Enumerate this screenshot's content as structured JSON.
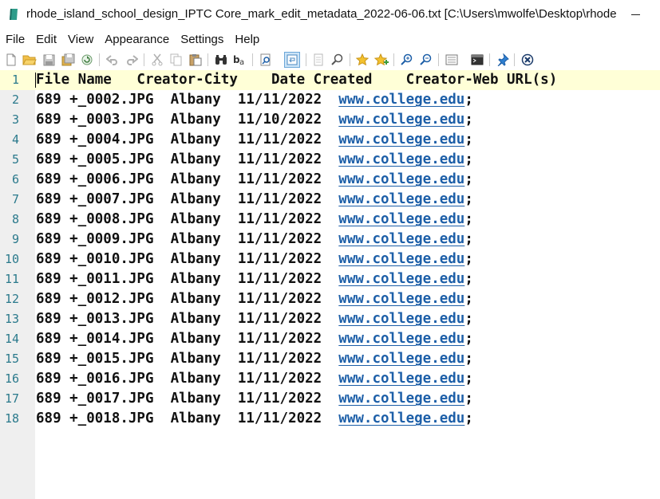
{
  "window": {
    "title": "rhode_island_school_design_IPTC Core_mark_edit_metadata_2022-06-06.txt [C:\\Users\\mwolfe\\Desktop\\rhode...",
    "minimize_label": "Minimize"
  },
  "menu": [
    "File",
    "Edit",
    "View",
    "Appearance",
    "Settings",
    "Help"
  ],
  "toolbar": {
    "icons": [
      "new-file-icon",
      "open-folder-icon",
      "save-icon",
      "save-all-icon",
      "reload-icon",
      "undo-icon",
      "redo-icon",
      "cut-icon",
      "copy-icon",
      "paste-icon",
      "find-icon",
      "replace-icon",
      "find-in-files-icon",
      "word-wrap-icon",
      "select-all-icon",
      "go-to-icon",
      "bookmark-icon",
      "bookmark-all-icon",
      "zoom-in-icon",
      "zoom-out-icon",
      "view-panel-icon",
      "terminal-icon",
      "pin-icon",
      "close-icon"
    ]
  },
  "editor": {
    "current_line": 1,
    "lines": [
      {
        "n": "1",
        "text": "File Name   Creator-City    Date Created    Creator-Web URL(s)",
        "url": "",
        "tail": ""
      },
      {
        "n": "2",
        "text": "689 +_0002.JPG  Albany  11/11/2022  ",
        "url": "www.college.edu",
        "tail": ";"
      },
      {
        "n": "3",
        "text": "689 +_0003.JPG  Albany  11/10/2022  ",
        "url": "www.college.edu",
        "tail": ";"
      },
      {
        "n": "4",
        "text": "689 +_0004.JPG  Albany  11/11/2022  ",
        "url": "www.college.edu",
        "tail": ";"
      },
      {
        "n": "5",
        "text": "689 +_0005.JPG  Albany  11/11/2022  ",
        "url": "www.college.edu",
        "tail": ";"
      },
      {
        "n": "6",
        "text": "689 +_0006.JPG  Albany  11/11/2022  ",
        "url": "www.college.edu",
        "tail": ";"
      },
      {
        "n": "7",
        "text": "689 +_0007.JPG  Albany  11/11/2022  ",
        "url": "www.college.edu",
        "tail": ";"
      },
      {
        "n": "8",
        "text": "689 +_0008.JPG  Albany  11/11/2022  ",
        "url": "www.college.edu",
        "tail": ";"
      },
      {
        "n": "9",
        "text": "689 +_0009.JPG  Albany  11/11/2022  ",
        "url": "www.college.edu",
        "tail": ";"
      },
      {
        "n": "10",
        "text": "689 +_0010.JPG  Albany  11/11/2022  ",
        "url": "www.college.edu",
        "tail": ";"
      },
      {
        "n": "11",
        "text": "689 +_0011.JPG  Albany  11/11/2022  ",
        "url": "www.college.edu",
        "tail": ";"
      },
      {
        "n": "12",
        "text": "689 +_0012.JPG  Albany  11/11/2022  ",
        "url": "www.college.edu",
        "tail": ";"
      },
      {
        "n": "13",
        "text": "689 +_0013.JPG  Albany  11/11/2022  ",
        "url": "www.college.edu",
        "tail": ";"
      },
      {
        "n": "14",
        "text": "689 +_0014.JPG  Albany  11/11/2022  ",
        "url": "www.college.edu",
        "tail": ";"
      },
      {
        "n": "15",
        "text": "689 +_0015.JPG  Albany  11/11/2022  ",
        "url": "www.college.edu",
        "tail": ";"
      },
      {
        "n": "16",
        "text": "689 +_0016.JPG  Albany  11/11/2022  ",
        "url": "www.college.edu",
        "tail": ";"
      },
      {
        "n": "17",
        "text": "689 +_0017.JPG  Albany  11/11/2022  ",
        "url": "www.college.edu",
        "tail": ";"
      },
      {
        "n": "18",
        "text": "689 +_0018.JPG  Albany  11/11/2022  ",
        "url": "www.college.edu",
        "tail": ";"
      }
    ]
  },
  "colors": {
    "current_line": "#ffffd7",
    "gutter": "#efefef",
    "line_number": "#2b7a8c",
    "url": "#1d5fa8"
  }
}
